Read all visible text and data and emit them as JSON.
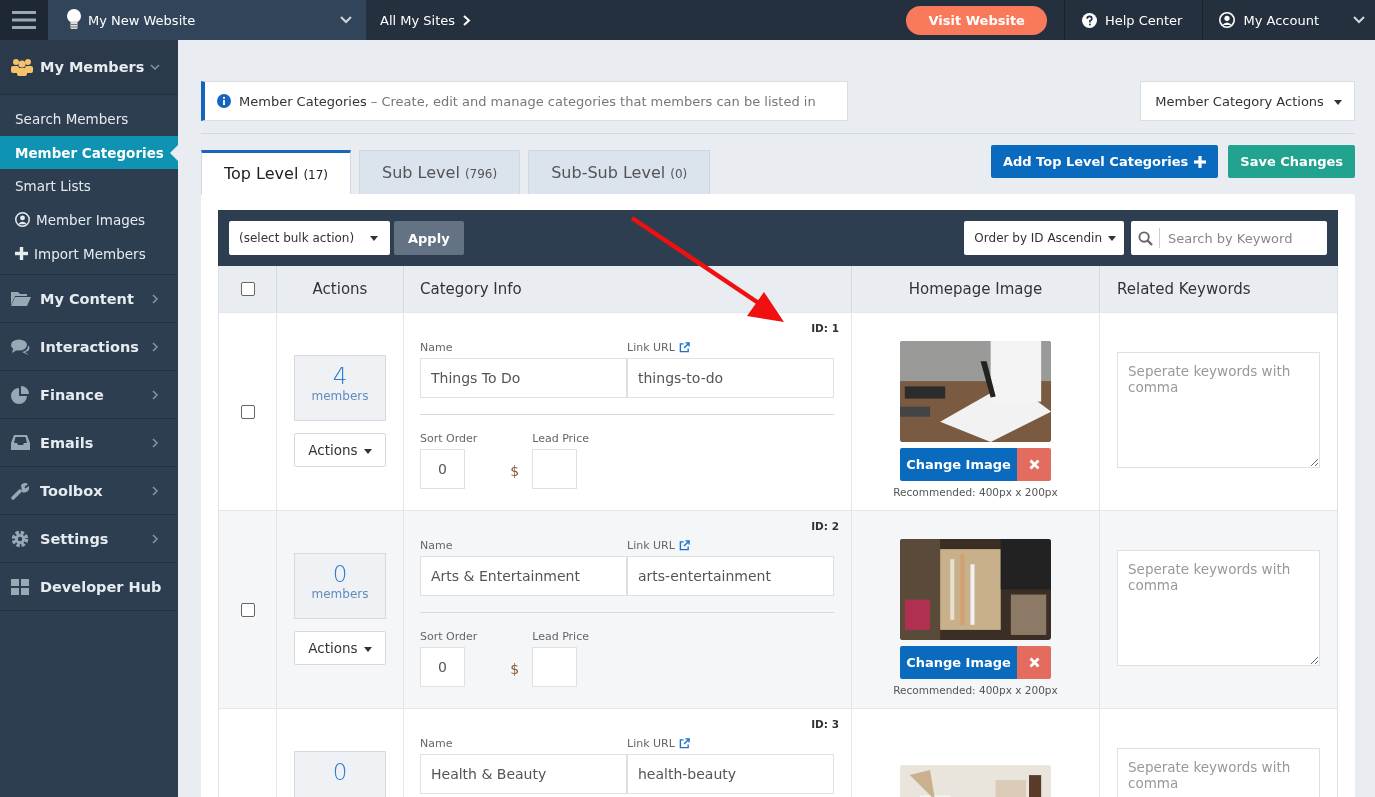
{
  "topbar": {
    "site": "My New Website",
    "all_sites": "All My Sites",
    "visit": "Visit Website",
    "help": "Help Center",
    "account": "My Account"
  },
  "sidebar": {
    "sections": [
      {
        "label": "My Members",
        "expanded": true,
        "children": [
          {
            "label": "Search Members",
            "selected": false
          },
          {
            "label": "Member Categories",
            "selected": true
          },
          {
            "label": "Smart Lists",
            "selected": false
          },
          {
            "label": "Member Images",
            "selected": false
          },
          {
            "label": "Import Members",
            "selected": false
          }
        ]
      },
      {
        "label": "My Content",
        "expanded": false
      },
      {
        "label": "Interactions",
        "expanded": false
      },
      {
        "label": "Finance",
        "expanded": false
      },
      {
        "label": "Emails",
        "expanded": false
      },
      {
        "label": "Toolbox",
        "expanded": false
      },
      {
        "label": "Settings",
        "expanded": false
      },
      {
        "label": "Developer Hub",
        "expanded": false
      }
    ]
  },
  "info": {
    "title": "Member Categories",
    "description": " – Create, edit and manage categories that members can be listed in"
  },
  "category_actions": "Member Category Actions",
  "tabs": [
    {
      "label": "Top Level",
      "count": "(17)",
      "selected": true
    },
    {
      "label": "Sub Level",
      "count": "(796)",
      "selected": false
    },
    {
      "label": "Sub-Sub Level",
      "count": "(0)",
      "selected": false
    }
  ],
  "add_button": "Add Top Level Categories",
  "save_button": "Save Changes",
  "toolbar": {
    "bulk": "(select bulk action)",
    "apply": "Apply",
    "order": "Order by ID Ascendin",
    "search_placeholder": "Search by Keyword"
  },
  "table": {
    "columns": [
      "Actions",
      "Category Info",
      "Homepage Image",
      "Related Keywords"
    ],
    "select_all_checked": false,
    "rows": [
      {
        "checked": false,
        "count": "4",
        "count_label": "members",
        "actions": "Actions",
        "id": "ID: 1",
        "name_label": "Name",
        "name": "Things To Do",
        "url_label": "Link URL",
        "url": "things-to-do",
        "sort_label": "Sort Order",
        "sort": "0",
        "price_label": "Lead Price",
        "currency": "$",
        "change_image": "Change Image",
        "recommended": "Recommended: 400px x 200px",
        "keywords_placeholder": "Seperate keywords with comma"
      },
      {
        "checked": false,
        "count": "0",
        "count_label": "members",
        "actions": "Actions",
        "id": "ID: 2",
        "name_label": "Name",
        "name": "Arts & Entertainment",
        "url_label": "Link URL",
        "url": "arts-entertainment",
        "sort_label": "Sort Order",
        "sort": "0",
        "price_label": "Lead Price",
        "currency": "$",
        "change_image": "Change Image",
        "recommended": "Recommended: 400px x 200px",
        "keywords_placeholder": "Seperate keywords with comma"
      },
      {
        "count": "0",
        "id": "ID: 3",
        "name_label": "Name",
        "name": "Health & Beauty",
        "url_label": "Link URL",
        "url": "health-beauty",
        "keywords_placeholder": "Seperate keywords with comma"
      }
    ]
  }
}
